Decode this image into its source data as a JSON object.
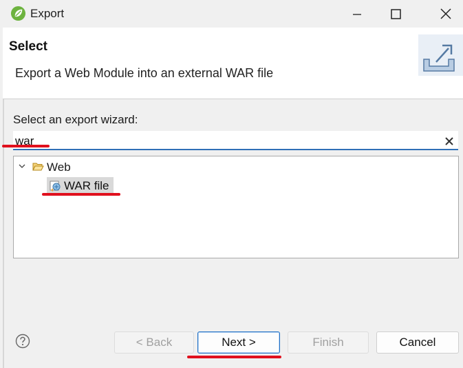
{
  "window": {
    "title": "Export",
    "app_icon": "spring-leaf-icon"
  },
  "header": {
    "title": "Select",
    "description": "Export a Web Module into an external WAR file",
    "banner_icon": "export-tray-icon"
  },
  "wizard": {
    "prompt": "Select an export wizard:",
    "filter_value": "war",
    "tree": [
      {
        "label": "Web",
        "expanded": true,
        "icon": "open-folder-icon",
        "children": [
          {
            "label": "WAR file",
            "selected": true,
            "icon": "war-file-icon"
          }
        ]
      }
    ]
  },
  "buttons": {
    "back": "< Back",
    "next": "Next >",
    "finish": "Finish",
    "cancel": "Cancel"
  },
  "colors": {
    "annotation_red": "#e0101d",
    "focus_blue": "#1f6fc5",
    "selection_gray": "#d9d9d9"
  }
}
